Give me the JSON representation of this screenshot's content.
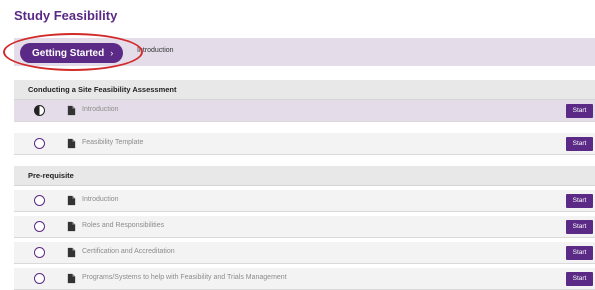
{
  "page": {
    "title": "Study Feasibility"
  },
  "top_bar": {
    "button_label": "Getting Started",
    "button_chevron": "›",
    "crumb": "Introduction"
  },
  "sections": [
    {
      "title": "Conducting a Site Feasibility Assessment",
      "items": [
        {
          "label": "Introduction",
          "status": "in-progress",
          "start": "Start"
        },
        {
          "label": "Feasibility Template",
          "status": "not-started",
          "start": "Start"
        }
      ]
    },
    {
      "title": "Pre-requisite",
      "items": [
        {
          "label": "Introduction",
          "status": "not-started",
          "start": "Start"
        },
        {
          "label": "Roles and Responsibilities",
          "status": "not-started",
          "start": "Start"
        },
        {
          "label": "Certification and Accreditation",
          "status": "not-started",
          "start": "Start"
        },
        {
          "label": "Programs/Systems to help with Feasibility and Trials Management",
          "status": "not-started",
          "start": "Start"
        }
      ]
    }
  ],
  "colors": {
    "accent": "#5b2a86",
    "highlight": "#d22a2a"
  }
}
